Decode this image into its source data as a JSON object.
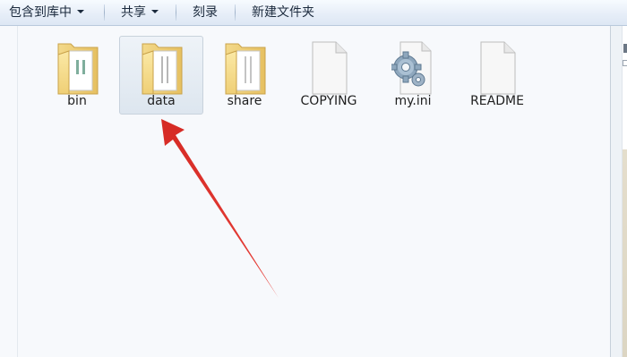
{
  "toolbar": {
    "items": [
      {
        "label": "包含到库中",
        "has_dropdown": true
      },
      {
        "label": "共享",
        "has_dropdown": true
      },
      {
        "label": "刻录",
        "has_dropdown": false
      },
      {
        "label": "新建文件夹",
        "has_dropdown": false
      }
    ]
  },
  "files": [
    {
      "name": "bin",
      "type": "folder",
      "selected": false
    },
    {
      "name": "data",
      "type": "folder",
      "selected": true
    },
    {
      "name": "share",
      "type": "folder",
      "selected": false
    },
    {
      "name": "COPYING",
      "type": "file",
      "icon": "blank-document-icon"
    },
    {
      "name": "my.ini",
      "type": "config-file",
      "icon": "settings-file-icon"
    },
    {
      "name": "README",
      "type": "file",
      "icon": "blank-document-icon"
    }
  ],
  "annotation": {
    "type": "arrow",
    "color": "#e8403a",
    "points_to": "data"
  }
}
